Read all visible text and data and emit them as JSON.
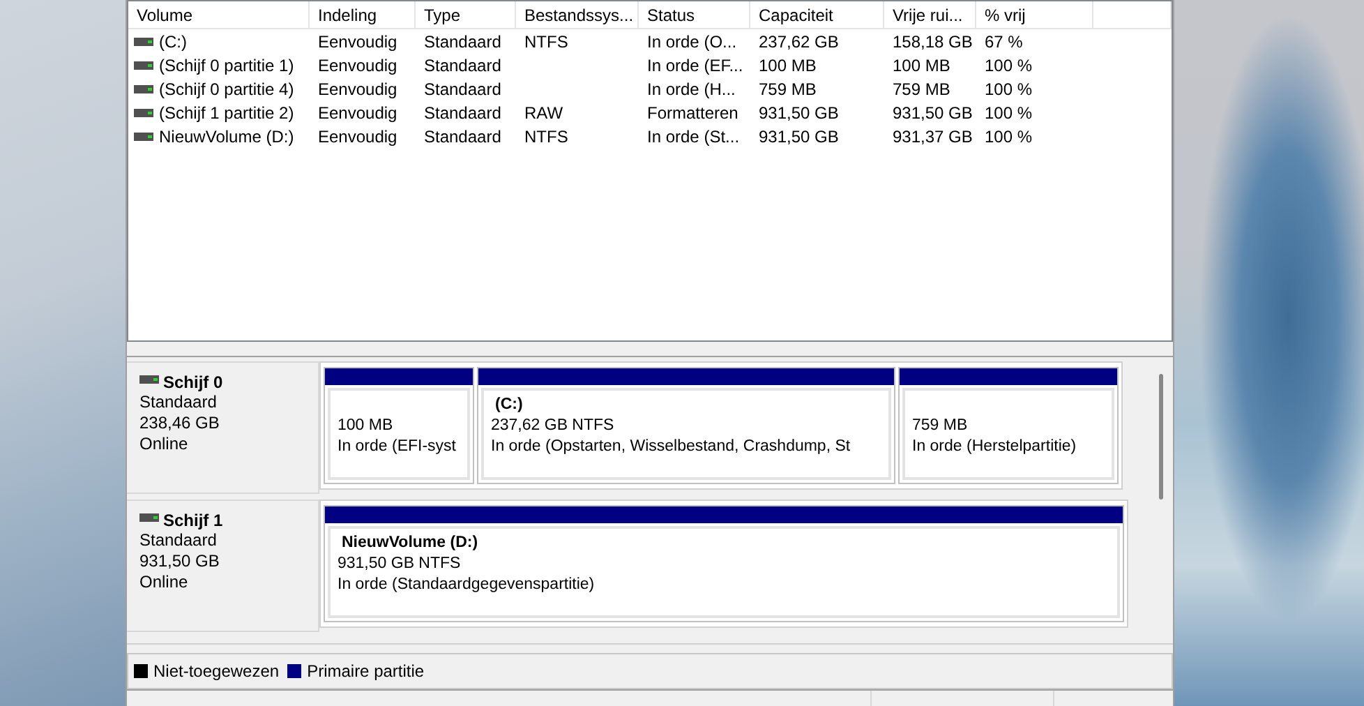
{
  "volume_list": {
    "columns": [
      "Volume",
      "Indeling",
      "Type",
      "Bestandssys...",
      "Status",
      "Capaciteit",
      "Vrije rui...",
      "% vrij"
    ],
    "rows": [
      {
        "cells": [
          "(C:)",
          "Eenvoudig",
          "Standaard",
          "NTFS",
          "In orde (O...",
          "237,62 GB",
          "158,18 GB",
          "67 %"
        ]
      },
      {
        "cells": [
          "(Schijf 0 partitie 1)",
          "Eenvoudig",
          "Standaard",
          "",
          "In orde (EF...",
          "100 MB",
          "100 MB",
          "100 %"
        ]
      },
      {
        "cells": [
          "(Schijf 0 partitie 4)",
          "Eenvoudig",
          "Standaard",
          "",
          "In orde (H...",
          "759 MB",
          "759 MB",
          "100 %"
        ]
      },
      {
        "cells": [
          "(Schijf 1 partitie 2)",
          "Eenvoudig",
          "Standaard",
          "RAW",
          "Formatteren",
          "931,50 GB",
          "931,50 GB",
          "100 %"
        ]
      },
      {
        "cells": [
          "NieuwVolume (D:)",
          "Eenvoudig",
          "Standaard",
          "NTFS",
          "In orde (St...",
          "931,50 GB",
          "931,37 GB",
          "100 %"
        ]
      }
    ]
  },
  "disks": [
    {
      "name": "Schijf 0",
      "type": "Standaard",
      "size": "238,46 GB",
      "state": "Online",
      "partitions": [
        {
          "kind": "primary",
          "size": "100 MB",
          "status": "In orde (EFI-syst"
        },
        {
          "kind": "primary",
          "title": "(C:)",
          "size": "237,62 GB NTFS",
          "status": "In orde (Opstarten, Wisselbestand, Crashdump, St"
        },
        {
          "kind": "primary",
          "size": "759 MB",
          "status": "In orde (Herstelpartitie)"
        }
      ]
    },
    {
      "name": "Schijf 1",
      "type": "Standaard",
      "size": "931,50 GB",
      "state": "Online",
      "partitions": [
        {
          "kind": "primary",
          "title": "NieuwVolume  (D:)",
          "size": "931,50 GB NTFS",
          "status": "In orde (Standaardgegevenspartitie)"
        }
      ]
    }
  ],
  "legend": [
    {
      "kind": "unallocated",
      "label": "Niet-toegewezen",
      "color": "#000000"
    },
    {
      "kind": "primary",
      "label": "Primaire partitie",
      "color": "#000080"
    }
  ]
}
